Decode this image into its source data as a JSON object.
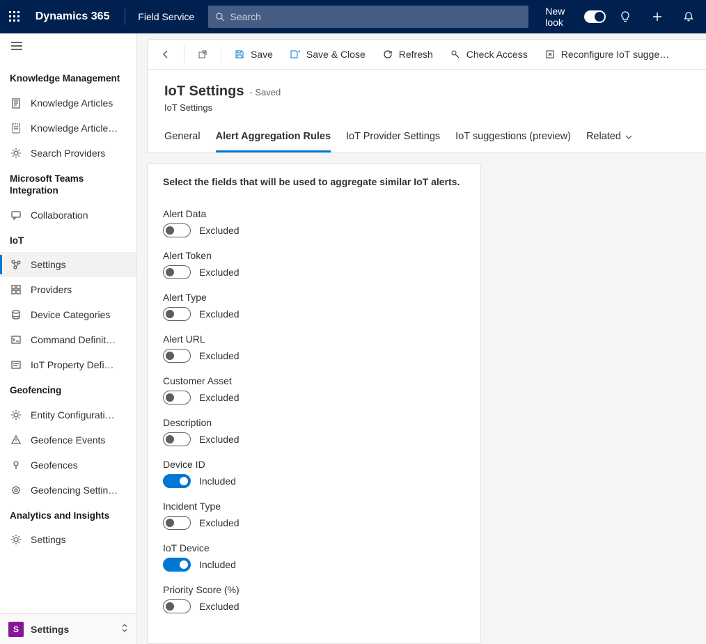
{
  "header": {
    "brand": "Dynamics 365",
    "service": "Field Service",
    "search_placeholder": "Search",
    "new_look_label": "New look"
  },
  "sidebar": {
    "sections": [
      {
        "title": "Knowledge Management",
        "items": [
          {
            "id": "knowledge-articles",
            "label": "Knowledge Articles",
            "icon": "doc"
          },
          {
            "id": "knowledge-article-templates",
            "label": "Knowledge Article…",
            "icon": "doc-dashed"
          },
          {
            "id": "search-providers",
            "label": "Search Providers",
            "icon": "gear"
          }
        ]
      },
      {
        "title": "Microsoft Teams Integration",
        "items": [
          {
            "id": "collaboration",
            "label": "Collaboration",
            "icon": "chat"
          }
        ]
      },
      {
        "title": "IoT",
        "items": [
          {
            "id": "settings",
            "label": "Settings",
            "icon": "nodes",
            "active": true
          },
          {
            "id": "providers",
            "label": "Providers",
            "icon": "grid"
          },
          {
            "id": "device-categories",
            "label": "Device Categories",
            "icon": "stack"
          },
          {
            "id": "command-definitions",
            "label": "Command Definit…",
            "icon": "cmd"
          },
          {
            "id": "iot-property-definitions",
            "label": "IoT Property Defi…",
            "icon": "prop"
          }
        ]
      },
      {
        "title": "Geofencing",
        "items": [
          {
            "id": "entity-configurations",
            "label": "Entity Configurati…",
            "icon": "gear"
          },
          {
            "id": "geofence-events",
            "label": "Geofence Events",
            "icon": "warn"
          },
          {
            "id": "geofences",
            "label": "Geofences",
            "icon": "pin"
          },
          {
            "id": "geofencing-settings",
            "label": "Geofencing Settin…",
            "icon": "target"
          }
        ]
      },
      {
        "title": "Analytics and Insights",
        "items": [
          {
            "id": "ai-settings",
            "label": "Settings",
            "icon": "gear"
          }
        ]
      }
    ],
    "footer": {
      "badge": "S",
      "label": "Settings"
    }
  },
  "commandbar": {
    "save": "Save",
    "save_close": "Save & Close",
    "refresh": "Refresh",
    "check_access": "Check Access",
    "reconfigure": "Reconfigure IoT sugge…"
  },
  "page": {
    "title": "IoT Settings",
    "status": "- Saved",
    "subtitle": "IoT Settings",
    "tabs": [
      {
        "id": "general",
        "label": "General"
      },
      {
        "id": "alert-aggregation-rules",
        "label": "Alert Aggregation Rules",
        "active": true
      },
      {
        "id": "iot-provider-settings",
        "label": "IoT Provider Settings"
      },
      {
        "id": "iot-suggestions",
        "label": "IoT suggestions (preview)"
      },
      {
        "id": "related",
        "label": "Related",
        "chevron": true
      }
    ],
    "card_heading": "Select the fields that will be used to aggregate similar IoT alerts.",
    "state_on": "Included",
    "state_off": "Excluded",
    "fields": [
      {
        "id": "alert-data",
        "label": "Alert Data",
        "on": false
      },
      {
        "id": "alert-token",
        "label": "Alert Token",
        "on": false
      },
      {
        "id": "alert-type",
        "label": "Alert Type",
        "on": false
      },
      {
        "id": "alert-url",
        "label": "Alert URL",
        "on": false
      },
      {
        "id": "customer-asset",
        "label": "Customer Asset",
        "on": false
      },
      {
        "id": "description",
        "label": "Description",
        "on": false
      },
      {
        "id": "device-id",
        "label": "Device ID",
        "on": true
      },
      {
        "id": "incident-type",
        "label": "Incident Type",
        "on": false
      },
      {
        "id": "iot-device",
        "label": "IoT Device",
        "on": true
      },
      {
        "id": "priority-score",
        "label": "Priority Score (%)",
        "on": false
      }
    ]
  }
}
